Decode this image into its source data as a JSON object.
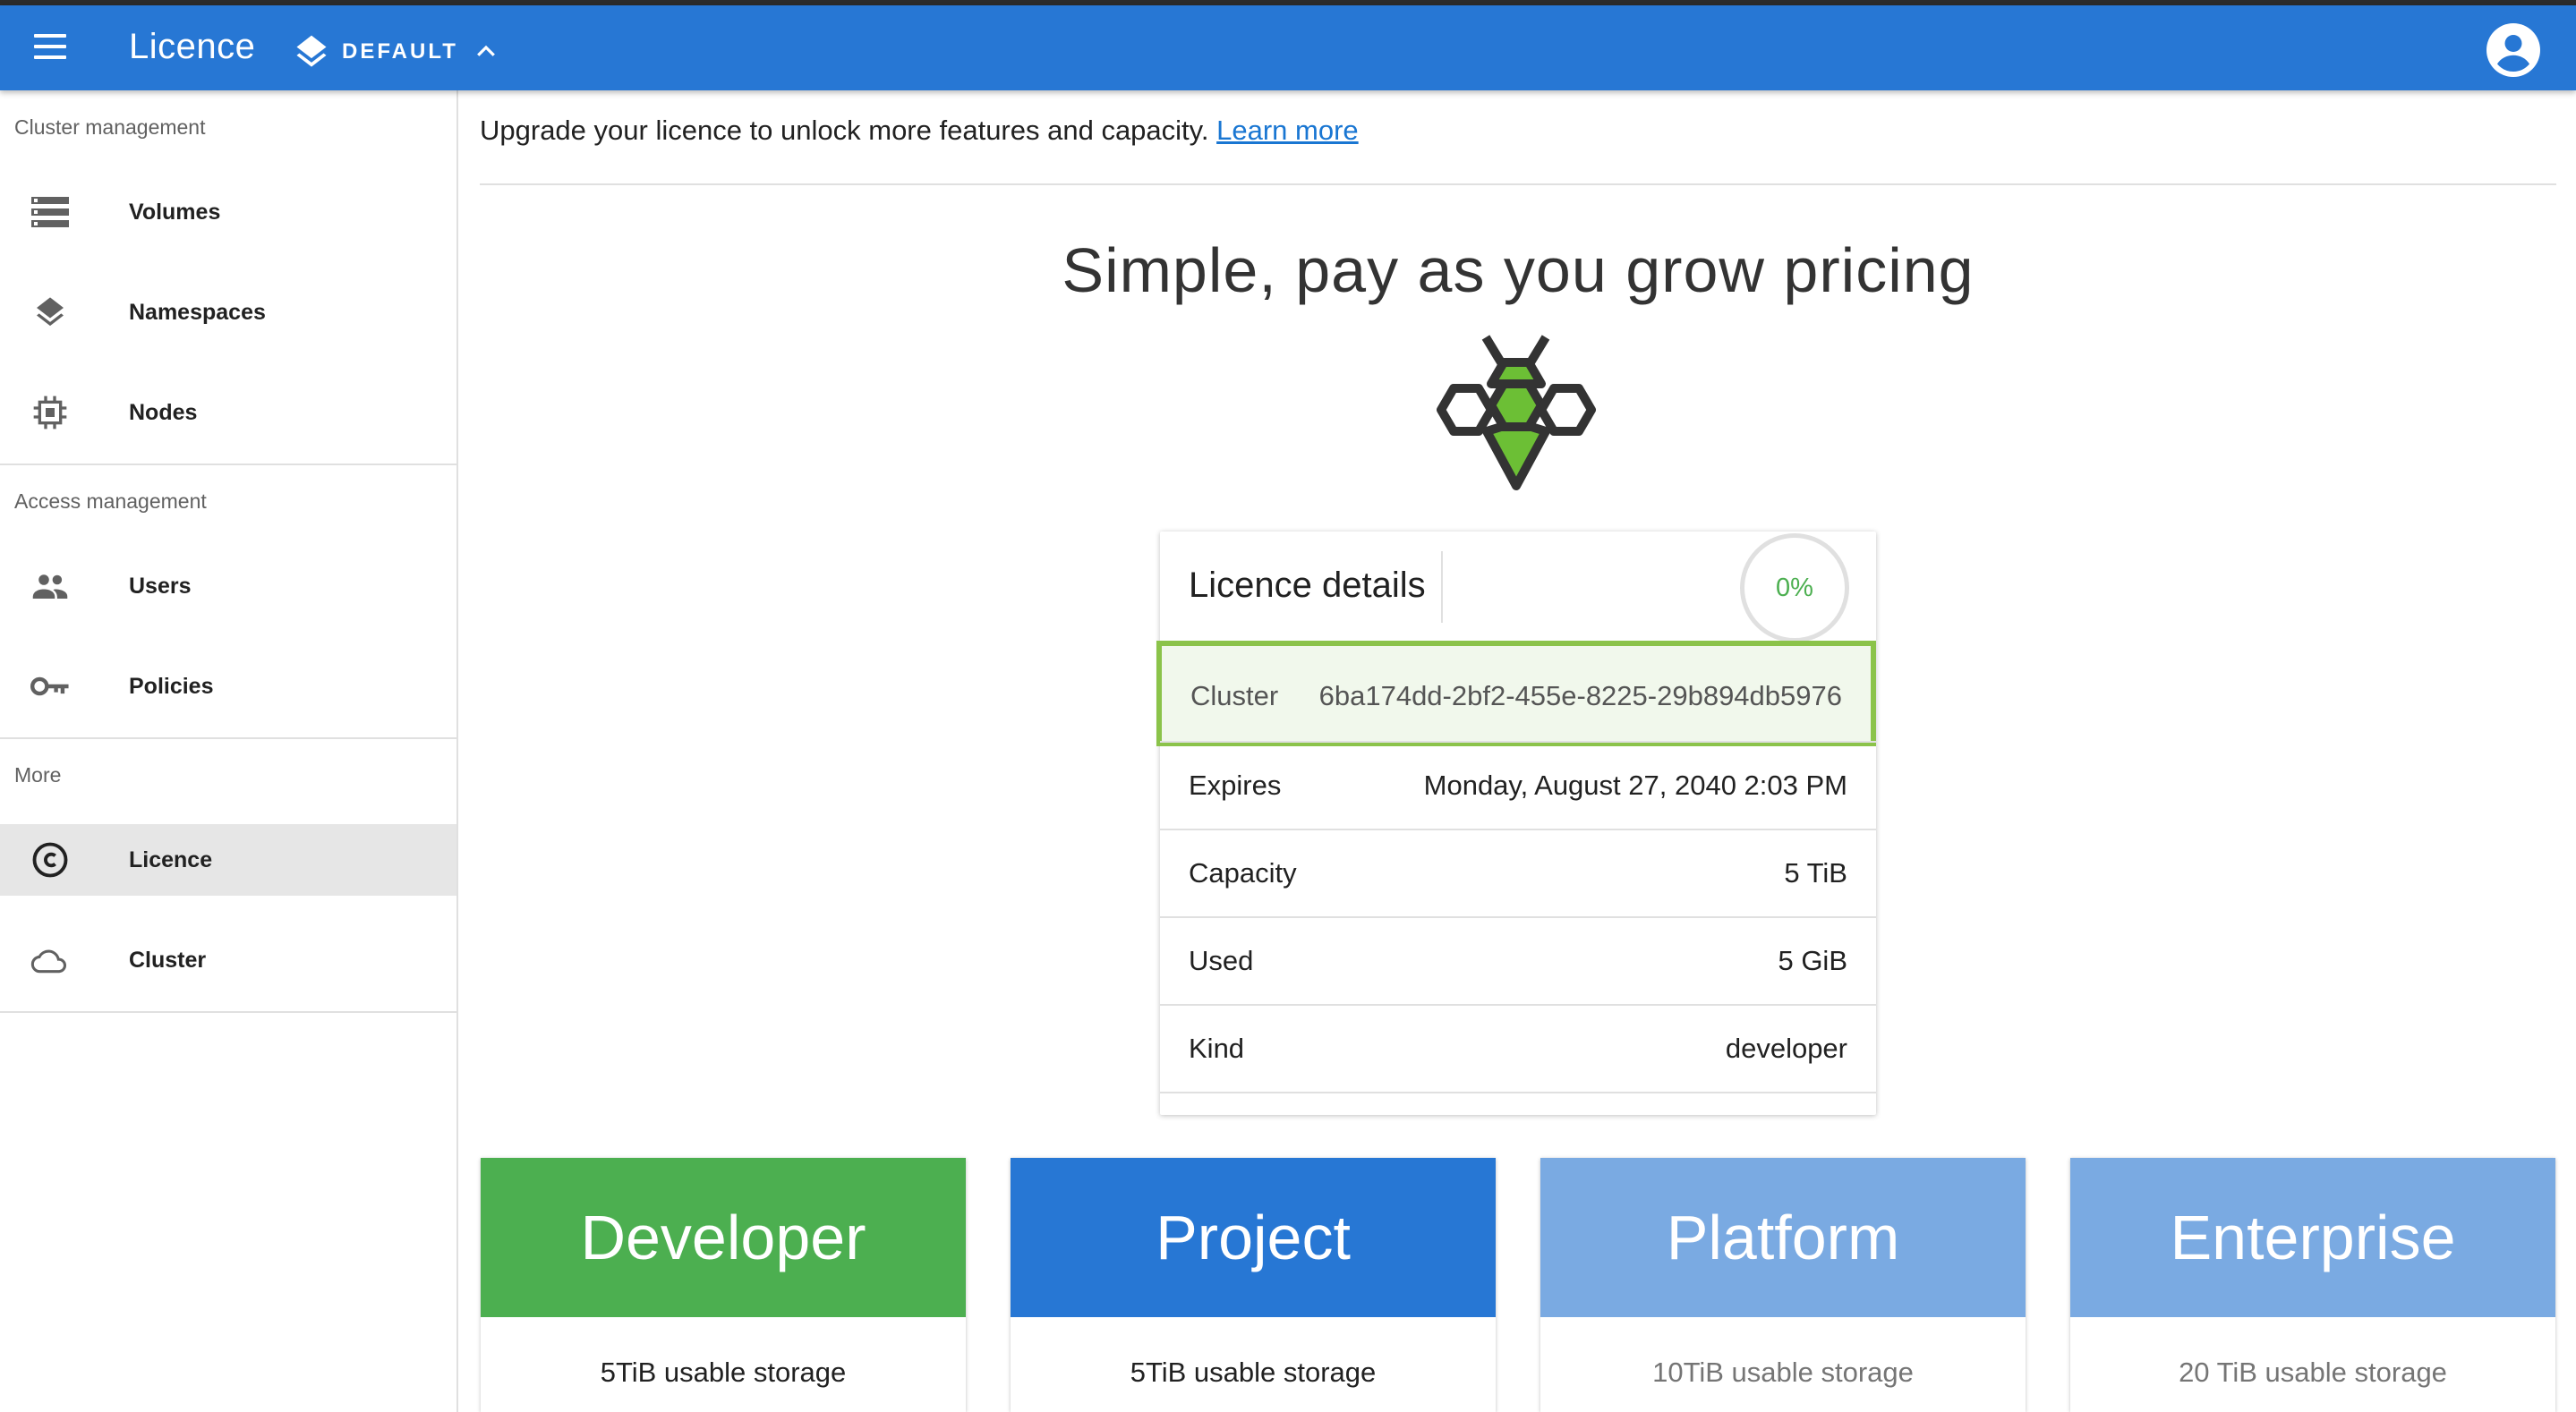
{
  "appbar": {
    "title": "Licence",
    "namespace": "DEFAULT"
  },
  "sidebar": {
    "sections": [
      {
        "title": "Cluster management",
        "items": [
          "Volumes",
          "Namespaces",
          "Nodes"
        ]
      },
      {
        "title": "Access management",
        "items": [
          "Users",
          "Policies"
        ]
      },
      {
        "title": "More",
        "items": [
          "Licence",
          "Cluster"
        ]
      }
    ],
    "active_item": "Licence"
  },
  "main": {
    "upgrade_text": "Upgrade your licence to unlock more features and capacity.",
    "learn_more": "Learn more",
    "hero_title": "Simple, pay as you grow pricing"
  },
  "licence_card": {
    "title": "Licence details",
    "usage_percent": "0%",
    "rows": [
      {
        "key": "Cluster",
        "value": "6ba174dd-2bf2-455e-8225-29b894db5976"
      },
      {
        "key": "Expires",
        "value": "Monday, August 27, 2040 2:03 PM"
      },
      {
        "key": "Capacity",
        "value": "5 TiB"
      },
      {
        "key": "Used",
        "value": "5 GiB"
      },
      {
        "key": "Kind",
        "value": "developer"
      }
    ]
  },
  "plans": [
    {
      "name": "Developer",
      "storage": "5TiB usable storage",
      "color": "#4caf50",
      "text_color": "#212121"
    },
    {
      "name": "Project",
      "storage": "5TiB usable storage",
      "color": "#2777d4",
      "text_color": "#212121"
    },
    {
      "name": "Platform",
      "storage": "10TiB usable storage",
      "color": "#7aaae2",
      "text_color": "#757575"
    },
    {
      "name": "Enterprise",
      "storage": "20 TiB usable storage",
      "color": "#7aaae2",
      "text_color": "#757575"
    }
  ],
  "colors": {
    "primary": "#2777d4",
    "success": "#4caf50",
    "highlight_border": "#8bc34a"
  }
}
